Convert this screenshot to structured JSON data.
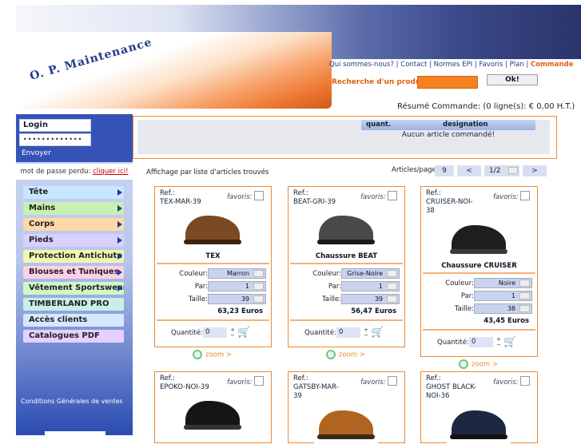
{
  "header": {
    "logo_text": "O. P. Maintenance",
    "nav": [
      "Qui sommes-nous?",
      "Contact",
      "Normes EPI",
      "Favoris",
      "Plan",
      "Commande"
    ],
    "search_label": "Recherche d'un produit:",
    "search_button": "Ok!",
    "cart_summary": "Résumé Commande: (0 ligne(s): € 0,00 H.T.)"
  },
  "login": {
    "login_value": "Login",
    "password_value": "•••••••••••••",
    "submit_label": "Envoyer",
    "lost_password_text": "mot de passe perdu:",
    "lost_password_link": "cliquer ici!"
  },
  "menu": [
    {
      "label": "Tête",
      "arrow": true,
      "color": "#c7e7ff"
    },
    {
      "label": "Mains",
      "arrow": true,
      "color": "#c8f0b0"
    },
    {
      "label": "Corps",
      "arrow": true,
      "color": "#ffd8a8"
    },
    {
      "label": "Pieds",
      "arrow": true,
      "color": "#d8d0ff"
    },
    {
      "label": "Protection Antichute",
      "arrow": true,
      "color": "#f0f6b0"
    },
    {
      "label": "Blouses et Tuniques",
      "arrow": true,
      "color": "#ffd0e8"
    },
    {
      "label": "Vêtement Sportswear",
      "arrow": true,
      "color": "#d0f7c6"
    },
    {
      "label": "TIMBERLAND PRO",
      "arrow": false,
      "color": "#c9efe6"
    },
    {
      "label": "Accès clients",
      "arrow": false,
      "color": "#d4e8ff"
    },
    {
      "label": "Catalogues PDF",
      "arrow": false,
      "color": "#e6d0ff"
    }
  ],
  "sidebar_footer": "Conditions Générales de ventes",
  "order": {
    "col_qty": "quant.",
    "col_designation": "designation",
    "empty_text": "Aucun article commandé!"
  },
  "listing": {
    "label": "Affichage par liste d'articles trouvés",
    "per_page_label": "Articles/page:",
    "per_page": "9",
    "prev": "<",
    "page": "1/2",
    "next": ">"
  },
  "labels": {
    "ref": "Ref.:",
    "favoris": "favoris:",
    "couleur": "Couleur:",
    "par": "Par:",
    "taille": "Taille:",
    "quantite": "Quantité:",
    "zoom": "zoom >"
  },
  "products": [
    {
      "ref": "TEX-MAR-39",
      "name": "TEX",
      "couleur": "Marron",
      "par": "1",
      "taille": "39",
      "price": "63,23 Euros",
      "qty": "0",
      "shoe_color": "#7a4a22",
      "sole_color": "#3a2412"
    },
    {
      "ref": "BEAT-GRI-39",
      "name": "Chaussure BEAT",
      "couleur": "Grise-Noire",
      "par": "1",
      "taille": "39",
      "price": "56,47 Euros",
      "qty": "0",
      "shoe_color": "#4a4a4a",
      "sole_color": "#1a1a1a"
    },
    {
      "ref": "CRUISER-NOI-38",
      "name": "Chaussure CRUISER",
      "couleur": "Noire",
      "par": "1",
      "taille": "38",
      "price": "43,45 Euros",
      "qty": "0",
      "shoe_color": "#1f1f22",
      "sole_color": "#3a3a3a"
    },
    {
      "ref": "EPOKO-NOI-39",
      "shoe_color": "#151515",
      "sole_color": "#333"
    },
    {
      "ref": "GATSBY-MAR-39",
      "shoe_color": "#b0641f",
      "sole_color": "#3c2a16"
    },
    {
      "ref": "GHOST BLACK-NOI-36",
      "shoe_color": "#1c2740",
      "sole_color": "#111"
    }
  ]
}
